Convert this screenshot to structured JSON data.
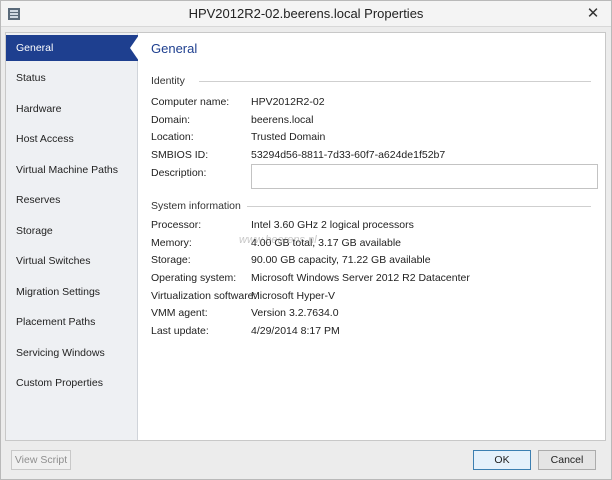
{
  "window": {
    "title": "HPV2012R2-02.beerens.local Properties",
    "close_glyph": "✕"
  },
  "sidebar": {
    "items": [
      {
        "label": "General",
        "active": true
      },
      {
        "label": "Status"
      },
      {
        "label": "Hardware"
      },
      {
        "label": "Host Access"
      },
      {
        "label": "Virtual Machine Paths"
      },
      {
        "label": "Reserves"
      },
      {
        "label": "Storage"
      },
      {
        "label": "Virtual Switches"
      },
      {
        "label": "Migration Settings"
      },
      {
        "label": "Placement Paths"
      },
      {
        "label": "Servicing Windows"
      },
      {
        "label": "Custom Properties"
      }
    ]
  },
  "main": {
    "heading": "General",
    "identity": {
      "title": "Identity",
      "computer_name_label": "Computer name:",
      "computer_name": "HPV2012R2-02",
      "domain_label": "Domain:",
      "domain": "beerens.local",
      "location_label": "Location:",
      "location": "Trusted Domain",
      "smbios_label": "SMBIOS ID:",
      "smbios": "53294d56-8811-7d33-60f7-a624de1f52b7",
      "description_label": "Description:",
      "description": ""
    },
    "system": {
      "title": "System information",
      "processor_label": "Processor:",
      "processor": "Intel  3.60 GHz 2 logical processors",
      "memory_label": "Memory:",
      "memory": "4.00 GB total, 3.17 GB available",
      "storage_label": "Storage:",
      "storage": "90.00 GB capacity, 71.22 GB available",
      "os_label": "Operating system:",
      "os": "Microsoft Windows Server 2012 R2 Datacenter",
      "virt_label": "Virtualization software:",
      "virt": "Microsoft Hyper-V",
      "vmm_label": "VMM agent:",
      "vmm": "Version 3.2.7634.0",
      "update_label": "Last update:",
      "update": "4/29/2014 8:17 PM"
    },
    "watermark": "www.beerens.nl"
  },
  "footer": {
    "view_script": "View Script",
    "ok": "OK",
    "cancel": "Cancel"
  },
  "colors": {
    "accent": "#1e3f8f",
    "sidebar_bg": "#eef0f3"
  }
}
